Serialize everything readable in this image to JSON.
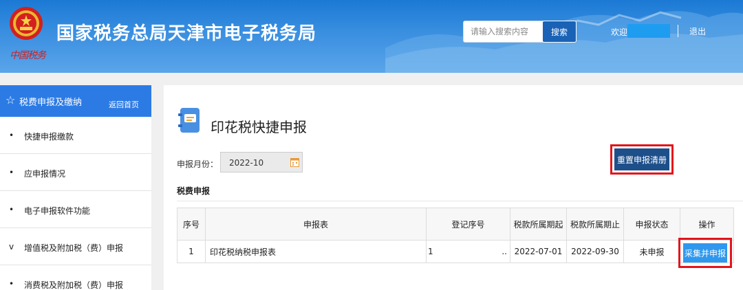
{
  "header": {
    "site_title": "国家税务总局天津市电子税务局",
    "signature_text": "中国税务",
    "search_placeholder": "请输入搜索内容",
    "search_button": "搜索",
    "welcome": "欢迎",
    "logout": "退出",
    "emblem_icon": "national-emblem-icon"
  },
  "sidebar": {
    "title": "税费申报及缴纳",
    "back_home": "返回首页",
    "items": [
      {
        "bullet": "•",
        "label": "快捷申报缴款"
      },
      {
        "bullet": "•",
        "label": "应申报情况"
      },
      {
        "bullet": "•",
        "label": "电子申报软件功能"
      },
      {
        "bullet": "v",
        "label": "增值税及附加税（费）申报"
      },
      {
        "bullet": "•",
        "label": "消费税及附加税（费）申报"
      }
    ]
  },
  "main": {
    "page_title": "印花税快捷申报",
    "month_label": "申报月份：",
    "month_value": "2022-10",
    "reset_button": "重置申报清册",
    "section_title": "税费申报",
    "table": {
      "headers": [
        "序号",
        "申报表",
        "登记序号",
        "税款所属期起",
        "税款所属期止",
        "申报状态",
        "操作"
      ],
      "rows": [
        {
          "seq": "1",
          "form": "印花税纳税申报表",
          "reg_mark": "1",
          "reg_ellipsis": "..",
          "start": "2022-07-01",
          "end": "2022-09-30",
          "status": "未申报",
          "action": "采集并申报"
        }
      ]
    }
  },
  "colors": {
    "header_blue": "#1b79d4",
    "sidebar_head": "#2c7be5",
    "reset_button": "#1d4f8a",
    "action_button": "#2f98ee",
    "highlight_red": "#e3141b"
  }
}
